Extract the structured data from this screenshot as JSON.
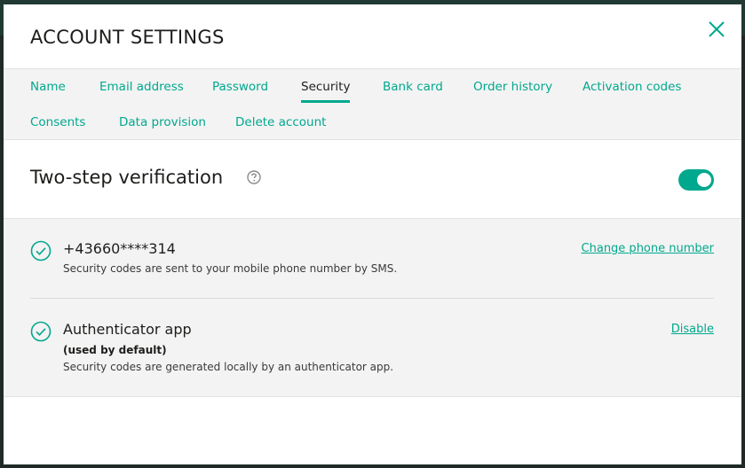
{
  "modal": {
    "title": "ACCOUNT SETTINGS",
    "close_icon": "close-icon"
  },
  "tabs": [
    {
      "label": "Name"
    },
    {
      "label": "Email address"
    },
    {
      "label": "Password"
    },
    {
      "label": "Security",
      "active": true
    },
    {
      "label": "Bank card"
    },
    {
      "label": "Order history"
    },
    {
      "label": "Activation codes"
    },
    {
      "label": "Consents"
    },
    {
      "label": "Data provision"
    },
    {
      "label": "Delete account"
    }
  ],
  "two_step": {
    "title": "Two-step verification",
    "help_icon": "question-circle-icon",
    "enabled": true
  },
  "methods": [
    {
      "icon": "check-circle-icon",
      "title": "+43660****314",
      "description": "Security codes are sent to your mobile phone number by SMS.",
      "action": "Change phone number"
    },
    {
      "icon": "check-circle-icon",
      "title": "Authenticator app",
      "subtitle": "(used by default)",
      "description": "Security codes are generated locally by an authenticator app.",
      "action": "Disable"
    }
  ],
  "colors": {
    "accent": "#00a88e",
    "text": "#1d1d1b",
    "panel": "#f3f3f3"
  }
}
